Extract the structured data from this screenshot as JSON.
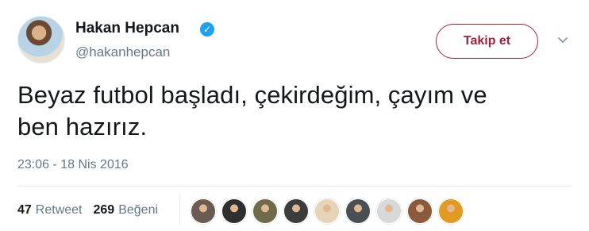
{
  "user": {
    "name": "Hakan Hepcan",
    "handle": "@hakanhepcan",
    "verified_icon": "verified-checkmark-icon"
  },
  "follow_button": {
    "label": "Takip et",
    "color": "#a3223d"
  },
  "menu": {
    "icon": "chevron-down-icon"
  },
  "tweet": {
    "text_line1": "Beyaz futbol başladı, çekirdeğim, çayım ve",
    "text_line2": "ben hazırız.",
    "timestamp": "23:06 - 18 Nis 2016"
  },
  "stats": {
    "retweets_count": "47",
    "retweets_label": "Retweet",
    "likes_count": "269",
    "likes_label": "Beğeni"
  },
  "likers": {
    "count": 9,
    "avatar_colors": [
      "#6b5b53",
      "#2f2f2f",
      "#6e6a4a",
      "#3c3c3c",
      "#e6d3b8",
      "#4b4f53",
      "#d8d8d8",
      "#8a5a3c",
      "#e39a20"
    ]
  },
  "colors": {
    "accent": "#1da1f2",
    "secondary_text": "#657786",
    "primary_text": "#14171a",
    "divider": "#e6ecf0"
  }
}
